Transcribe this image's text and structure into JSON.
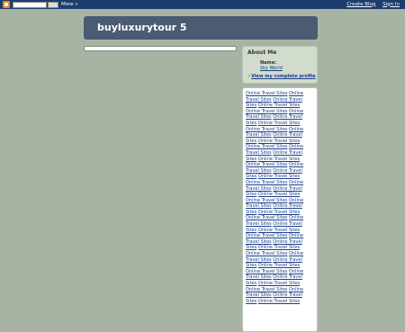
{
  "navbar": {
    "more_label": "More »",
    "create_blog": "Create Blog",
    "sign_in": "Sign In"
  },
  "header": {
    "title": "buyluxurytour 5"
  },
  "about": {
    "title": "About Me",
    "name_label": "Name:",
    "name": "Sky World",
    "profile_link": "View my complete profile"
  },
  "links": {
    "item_text": "Online Travel Sites",
    "count": 48
  }
}
